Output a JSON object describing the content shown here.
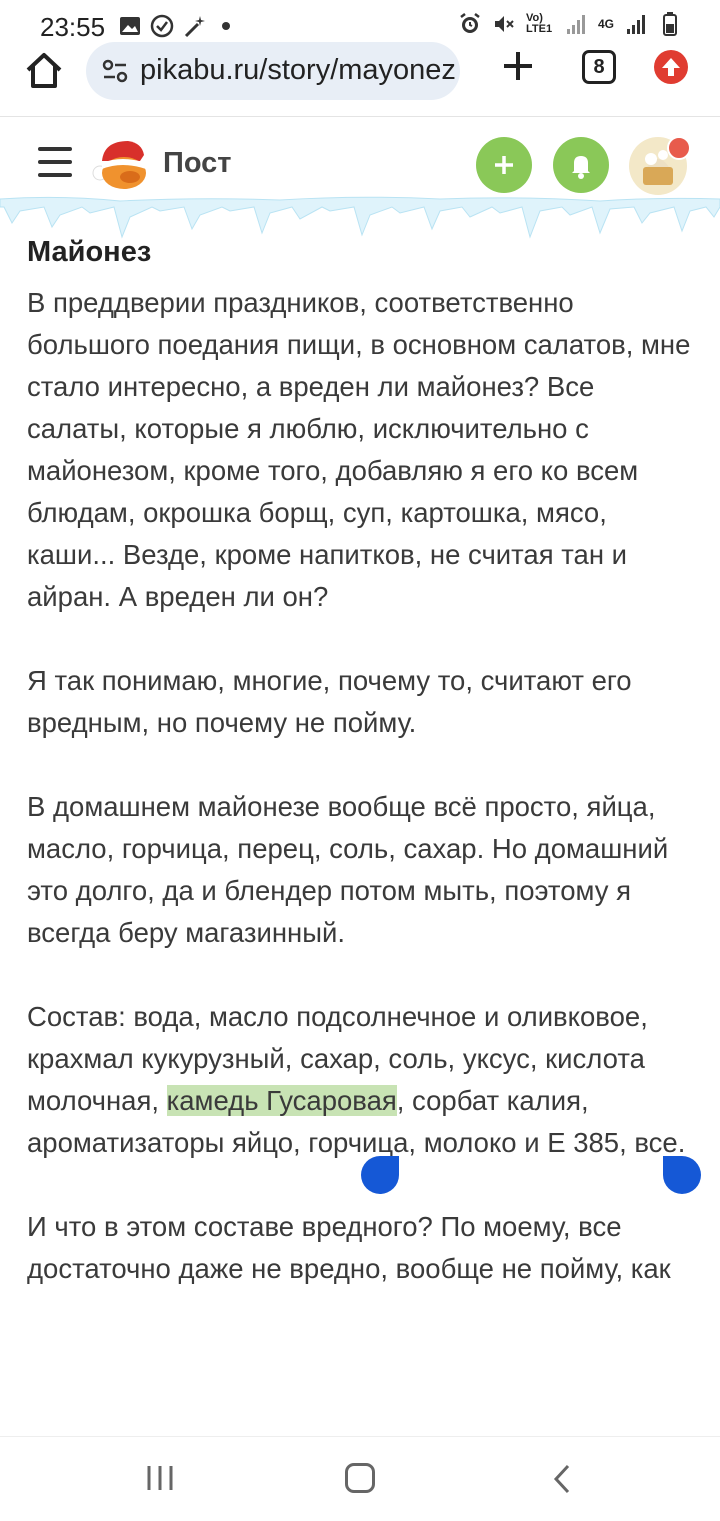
{
  "status_bar": {
    "time": "23:55",
    "network_label": "Vo) LTE1",
    "net_4g": "4G"
  },
  "browser": {
    "url": "pikabu.ru/story/mayonez",
    "tab_count": "8"
  },
  "header": {
    "title": "Пост"
  },
  "article": {
    "title": "Майонез",
    "paragraph1": "В преддверии праздников, соответственно большого поедания пищи, в основном салатов, мне стало интересно, а вреден ли майонез? Все салаты, которые я люблю, исключительно с майонезом, кроме того, добавляю я его ко всем блюдам, окрошка борщ, суп, картошка, мясо, каши... Везде, кроме напитков, не считая тан и айран. А вреден ли он?",
    "paragraph2": "Я так понимаю, многие, почему то, считают его вредным, но почему не пойму.",
    "paragraph3": "В домашнем майонезе вообще всё просто, яйца, масло, горчица, перец, соль, сахар. Но домашний это долго, да и блендер потом мыть, поэтому я всегда беру магазинный.",
    "paragraph4_before": "Состав: вода, масло подсолнечное и оливковое, крахмал кукурузный, сахар, соль, уксус, кислота молочная, ",
    "paragraph4_selected": "камедь Гусаровая",
    "paragraph4_after": ", сорбат калия, ароматизаторы яйцо, горчица, молоко и Е 385, все.",
    "paragraph5": "И что в этом составе вредного? По моему, все достаточно даже не вредно, вообще не пойму, как эти простые ингредиенты даже покупного майонеза могут навредить"
  },
  "colors": {
    "accent_green": "#8ac858",
    "selection_highlight": "#c8e3b4",
    "selection_handle": "#1558d6",
    "update_red": "#e03c31"
  },
  "icons": {
    "home": "home-icon",
    "site_settings": "tune-icon",
    "new_tab": "plus-icon",
    "update": "arrow-up-icon",
    "menu": "hamburger-icon",
    "add_post": "plus-icon",
    "notifications": "bell-icon",
    "nav_recents": "recents-icon",
    "nav_home": "home-square-icon",
    "nav_back": "chevron-left-icon"
  }
}
